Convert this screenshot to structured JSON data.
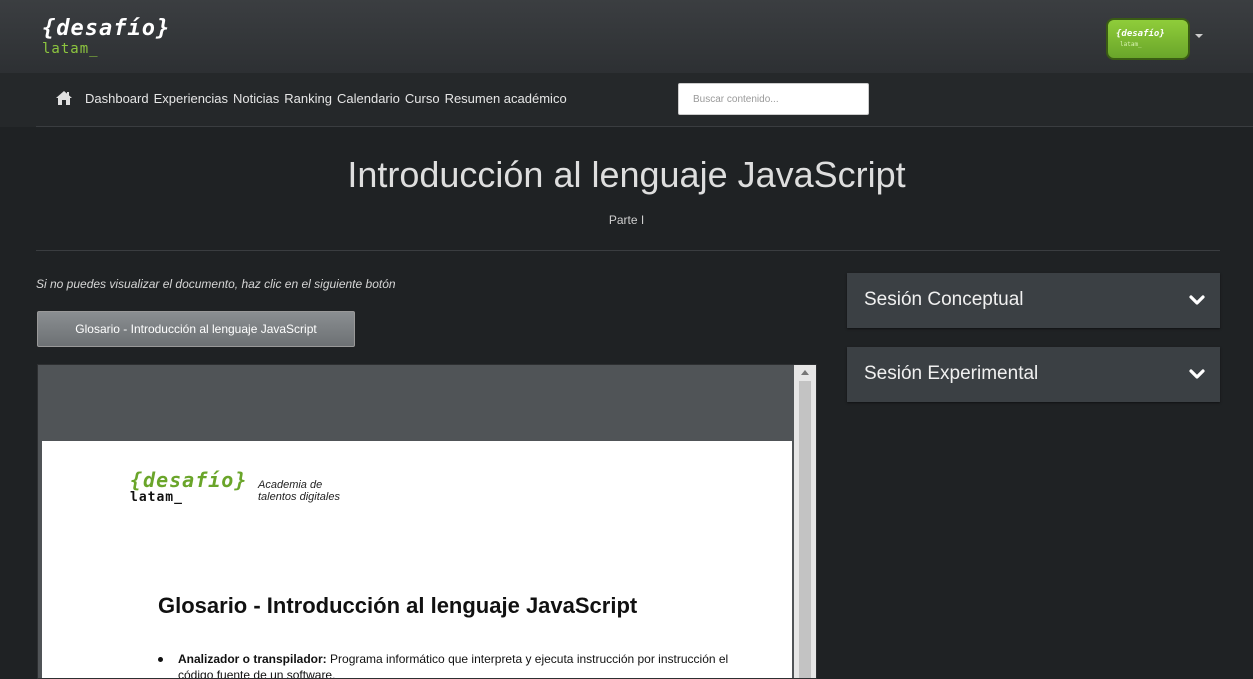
{
  "header": {
    "brand_line1": "{desafío}",
    "brand_line2": "latam_",
    "avatar_line1": "{desafío}",
    "avatar_line2": "latam_"
  },
  "nav": {
    "items": [
      {
        "label": "Dashboard"
      },
      {
        "label": "Experiencias"
      },
      {
        "label": "Noticias"
      },
      {
        "label": "Ranking"
      },
      {
        "label": "Calendario"
      },
      {
        "label": "Curso"
      },
      {
        "label": "Resumen académico"
      }
    ],
    "search_placeholder": "Buscar contenido..."
  },
  "main": {
    "title": "Introducción al lenguaje JavaScript",
    "subtitle": "Parte I",
    "note": "Si no puedes visualizar el documento, haz clic en el siguiente botón",
    "doc_button": "Glosario - Introducción al lenguaje JavaScript"
  },
  "document": {
    "logo_line1": "{desafío}",
    "logo_line2": "latam_",
    "tagline_line1": "Academia de",
    "tagline_line2": "talentos digitales",
    "heading": "Glosario - Introducción al lenguaje JavaScript",
    "bullet_term": "Analizador o transpilador:",
    "bullet_text": " Programa informático que interpreta y ejecuta instrucción por instrucción el código fuente de un software."
  },
  "sidebar": {
    "sections": [
      {
        "label": "Sesión Conceptual"
      },
      {
        "label": "Sesión Experimental"
      }
    ]
  },
  "colors": {
    "accent_green": "#8dc63f",
    "topbar": "#35383b",
    "background": "#1f2224",
    "panel": "#3b4044"
  }
}
